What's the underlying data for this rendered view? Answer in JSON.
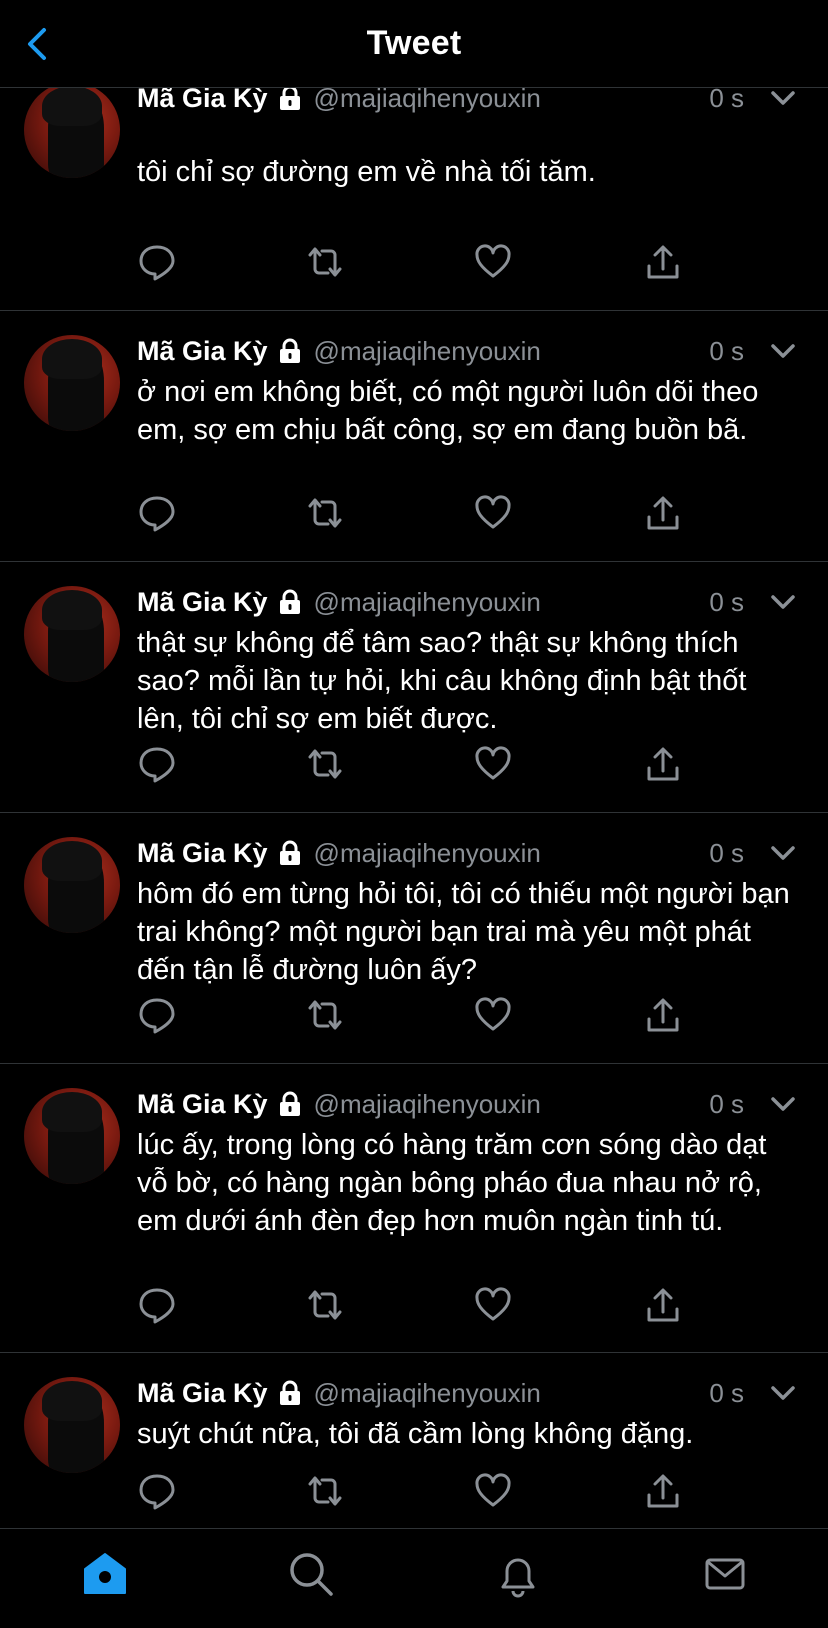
{
  "header": {
    "title": "Tweet",
    "back_icon": "chevron-left-icon"
  },
  "colors": {
    "background": "#000000",
    "accent": "#1d9bf0",
    "muted": "#8b9096",
    "divider": "#2f3336"
  },
  "tweets": [
    {
      "name": "Mã Gia Kỳ",
      "handle": "@majiaqihenyouxin",
      "time": "0 s",
      "text": "tôi chỉ sợ đường em về nhà tối tăm."
    },
    {
      "name": "Mã Gia Kỳ",
      "handle": "@majiaqihenyouxin",
      "time": "0 s",
      "text": "ở nơi em không biết, có một người luôn dõi theo em, sợ em chịu bất công, sợ em đang buồn bã."
    },
    {
      "name": "Mã Gia Kỳ",
      "handle": "@majiaqihenyouxin",
      "time": "0 s",
      "text": "thật sự không để tâm sao? thật sự không thích sao? mỗi lần tự hỏi, khi câu không định bật thốt lên, tôi chỉ sợ em biết được."
    },
    {
      "name": "Mã Gia Kỳ",
      "handle": "@majiaqihenyouxin",
      "time": "0 s",
      "text": "hôm đó em từng hỏi tôi, tôi có thiếu một người bạn trai không? một người bạn trai mà yêu một phát đến tận lễ đường luôn ấy?"
    },
    {
      "name": "Mã Gia Kỳ",
      "handle": "@majiaqihenyouxin",
      "time": "0 s",
      "text": "lúc ấy, trong lòng có hàng trăm cơn sóng dào dạt vỗ bờ, có hàng ngàn bông pháo đua nhau nở rộ, em dưới ánh đèn đẹp hơn muôn ngàn tinh tú."
    },
    {
      "name": "Mã Gia Kỳ",
      "handle": "@majiaqihenyouxin",
      "time": "0 s",
      "text": "suýt chút nữa, tôi đã cầm lòng không đặng."
    }
  ],
  "tweet_icons": {
    "lock": "lock-icon",
    "caret": "chevron-down-icon",
    "reply": "reply-icon",
    "retweet": "retweet-icon",
    "like": "heart-icon",
    "share": "share-icon"
  },
  "tabbar": {
    "items": [
      "home-icon",
      "search-icon",
      "bell-icon",
      "mail-icon"
    ],
    "active": "home-icon"
  }
}
